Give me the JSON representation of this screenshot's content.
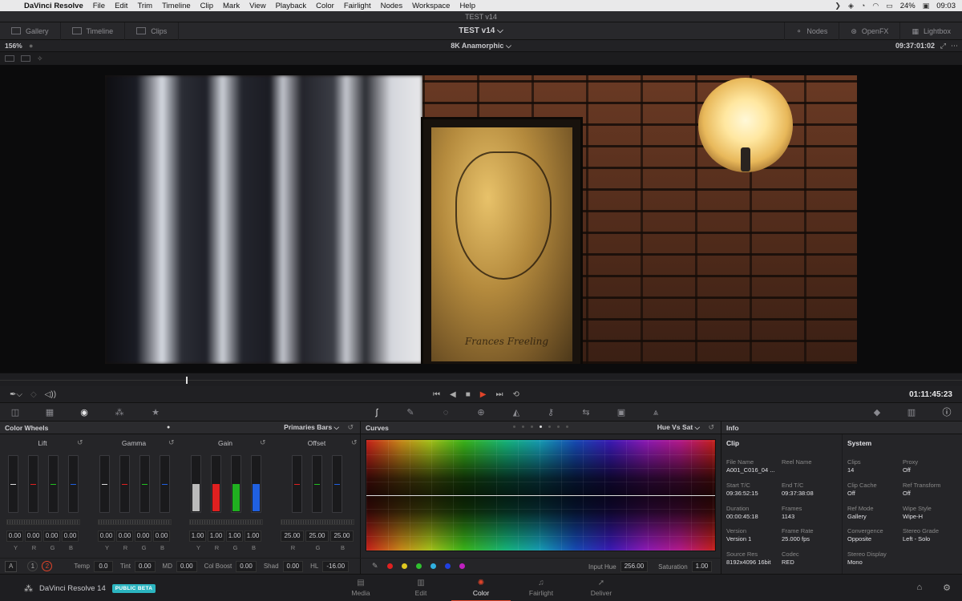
{
  "menubar": {
    "items": [
      "DaVinci Resolve",
      "File",
      "Edit",
      "Trim",
      "Timeline",
      "Clip",
      "Mark",
      "View",
      "Playback",
      "Color",
      "Fairlight",
      "Nodes",
      "Workspace",
      "Help"
    ],
    "battery": "24%",
    "clock": "09:03"
  },
  "window": {
    "title": "TEST v14"
  },
  "toolbar": {
    "gallery": "Gallery",
    "timeline": "Timeline",
    "clips": "Clips",
    "project_title": "TEST v14",
    "nodes": "Nodes",
    "openfx": "OpenFX",
    "lightbox": "Lightbox"
  },
  "viewer": {
    "zoom": "156%",
    "timeline_name": "8K Anamorphic",
    "timecode": "09:37:01:02",
    "playhead_fraction": 0.193
  },
  "transport": {
    "timecode": "01:11:45:23"
  },
  "color_wheels": {
    "title": "Color Wheels",
    "mode": "Primaries Bars",
    "wheels": [
      {
        "name": "Lift",
        "values": [
          "0.00",
          "0.00",
          "0.00",
          "0.00"
        ],
        "labels": [
          "Y",
          "R",
          "G",
          "B"
        ]
      },
      {
        "name": "Gamma",
        "values": [
          "0.00",
          "0.00",
          "0.00",
          "0.00"
        ],
        "labels": [
          "Y",
          "R",
          "G",
          "B"
        ]
      },
      {
        "name": "Gain",
        "values": [
          "1.00",
          "1.00",
          "1.00",
          "1.00"
        ],
        "labels": [
          "Y",
          "R",
          "G",
          "B"
        ]
      },
      {
        "name": "Offset",
        "values": [
          "25.00",
          "25.00",
          "25.00"
        ],
        "labels": [
          "R",
          "G",
          "B"
        ]
      }
    ],
    "footer": {
      "a_button": "A",
      "page1": "1",
      "page2": "2",
      "temp_label": "Temp",
      "temp": "0.0",
      "tint_label": "Tint",
      "tint": "0.00",
      "md_label": "MD",
      "md": "0.00",
      "colboost_label": "Col Boost",
      "colboost": "0.00",
      "shad_label": "Shad",
      "shad": "0.00",
      "hl_label": "HL",
      "hl": "-16.00"
    }
  },
  "curves": {
    "title": "Curves",
    "mode": "Hue Vs Sat",
    "swatches": [
      "#e02020",
      "#e0c820",
      "#30c030",
      "#30b0e0",
      "#2040e0",
      "#c020c0"
    ],
    "input_hue_label": "Input Hue",
    "input_hue": "256.00",
    "saturation_label": "Saturation",
    "saturation": "1.00"
  },
  "info": {
    "title": "Info",
    "clip_section": "Clip",
    "system_section": "System",
    "clip": [
      {
        "k": "File Name",
        "v": "A001_C016_04 ..."
      },
      {
        "k": "Reel Name",
        "v": ""
      },
      {
        "k": "Start T/C",
        "v": "09:36:52:15"
      },
      {
        "k": "End T/C",
        "v": "09:37:38:08"
      },
      {
        "k": "Duration",
        "v": "00:00:45:18"
      },
      {
        "k": "Frames",
        "v": "1143"
      },
      {
        "k": "Version",
        "v": "Version 1"
      },
      {
        "k": "Frame Rate",
        "v": "25.000 fps"
      },
      {
        "k": "Source Res",
        "v": "8192x4096 16bit"
      },
      {
        "k": "Codec",
        "v": "RED"
      }
    ],
    "system": [
      {
        "k": "Clips",
        "v": "14"
      },
      {
        "k": "Proxy",
        "v": "Off"
      },
      {
        "k": "Clip Cache",
        "v": "Off"
      },
      {
        "k": "Ref Transform",
        "v": "Off"
      },
      {
        "k": "Ref Mode",
        "v": "Gallery"
      },
      {
        "k": "Wipe Style",
        "v": "Wipe-H"
      },
      {
        "k": "Convergence",
        "v": "Opposite"
      },
      {
        "k": "Stereo Grade",
        "v": "Left - Solo"
      },
      {
        "k": "Stereo Display",
        "v": "Mono"
      }
    ]
  },
  "pages": {
    "brand": "DaVinci Resolve 14",
    "beta": "PUBLIC BETA",
    "tabs": [
      "Media",
      "Edit",
      "Color",
      "Fairlight",
      "Deliver"
    ],
    "active": "Color"
  },
  "image_text": {
    "signature": "Frances Freeling"
  }
}
